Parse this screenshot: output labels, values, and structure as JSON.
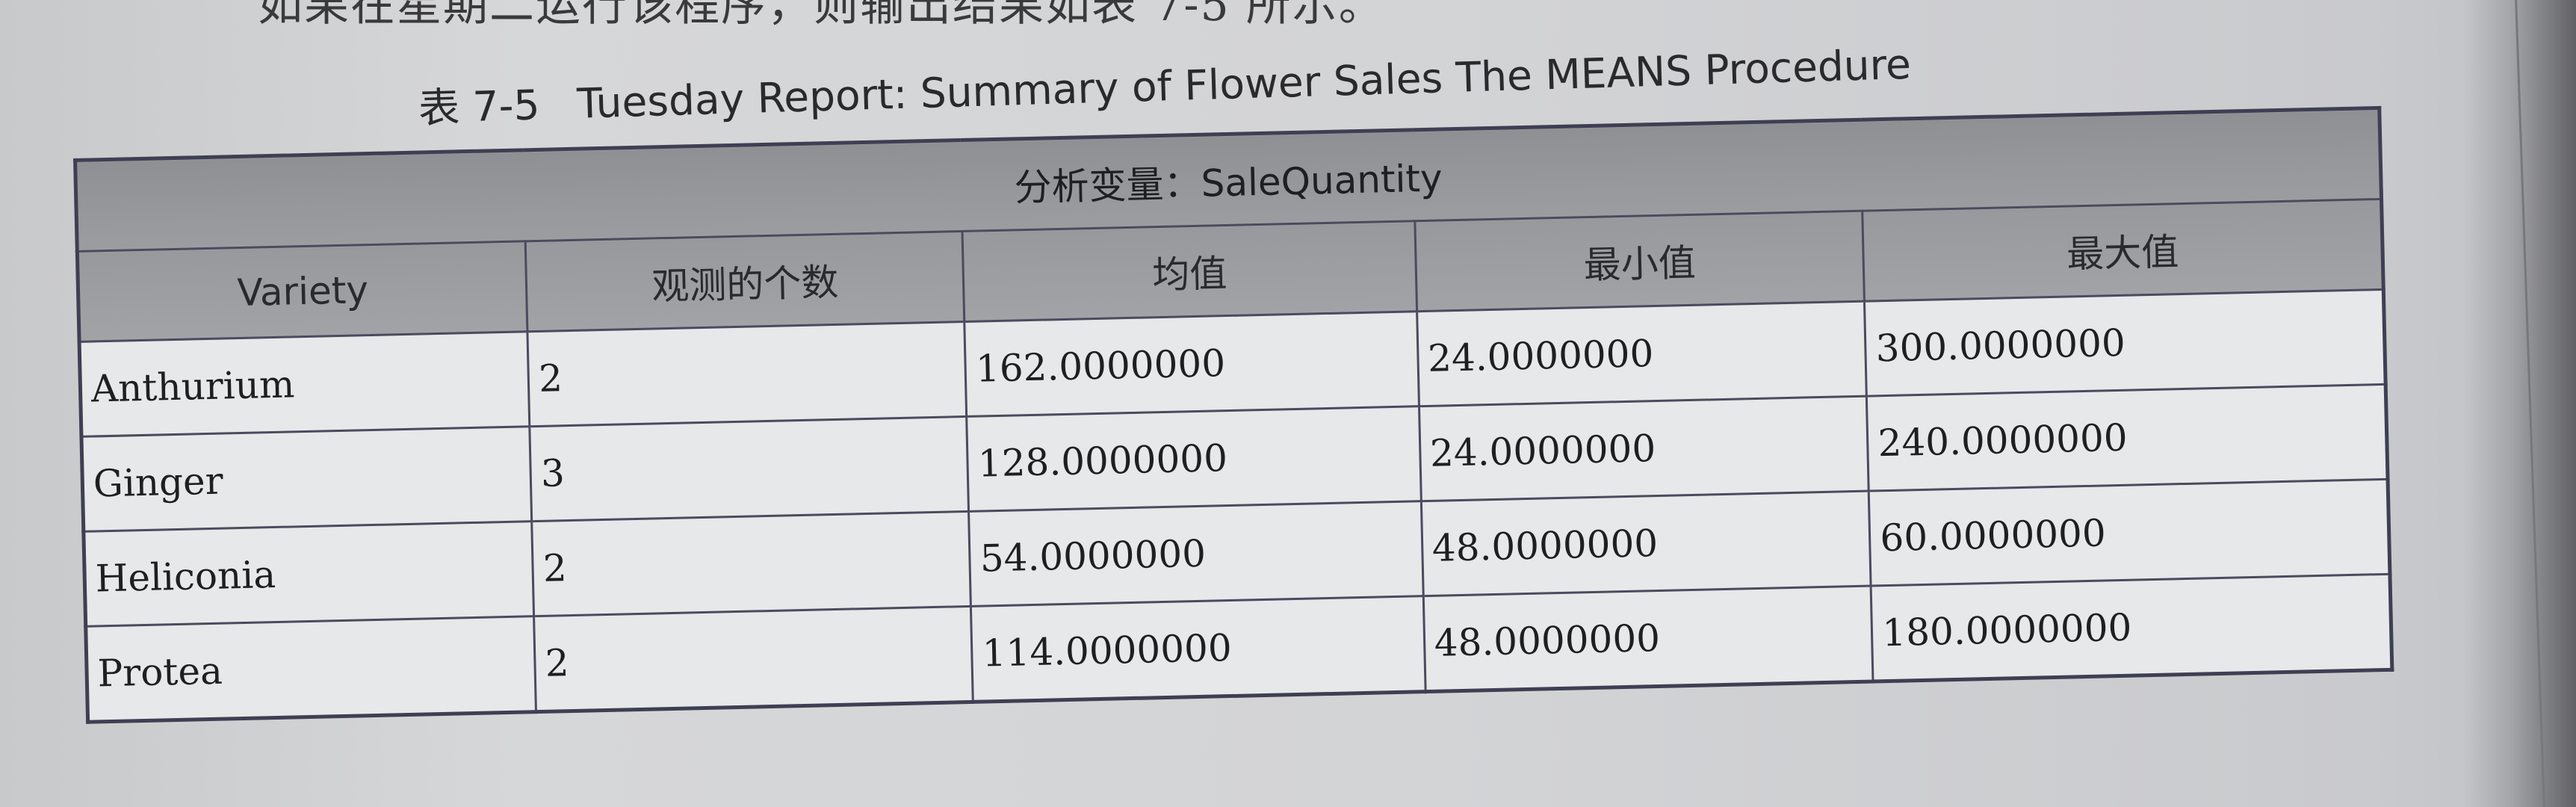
{
  "top_text": "如果在星期二运行该程序，则输出结果如表 7-5 所示。",
  "caption": {
    "number": "表 7-5",
    "title": "Tuesday Report: Summary of Flower Sales The MEANS Procedure"
  },
  "table": {
    "analysis_label": "分析变量：SaleQuantity",
    "columns": [
      "Variety",
      "观测的个数",
      "均值",
      "最小值",
      "最大值"
    ],
    "rows": [
      [
        "Anthurium",
        "2",
        "162.0000000",
        "24.0000000",
        "300.0000000"
      ],
      [
        "Ginger",
        "3",
        "128.0000000",
        "24.0000000",
        "240.0000000"
      ],
      [
        "Heliconia",
        "2",
        "54.0000000",
        "48.0000000",
        "60.0000000"
      ],
      [
        "Protea",
        "2",
        "114.0000000",
        "48.0000000",
        "180.0000000"
      ]
    ]
  }
}
